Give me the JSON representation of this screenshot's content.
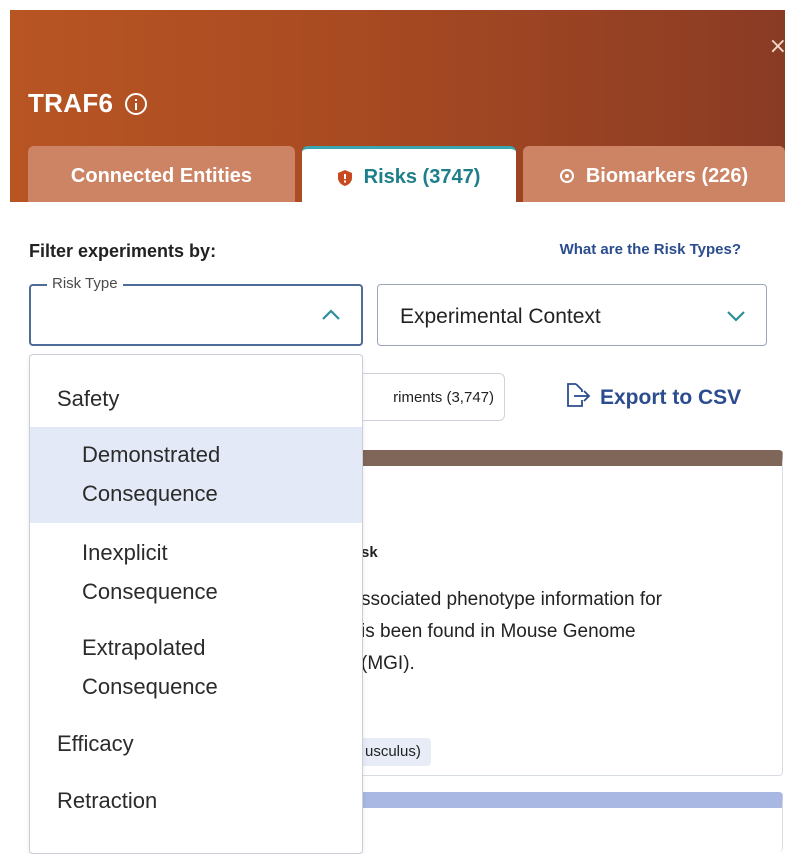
{
  "header": {
    "title": "TRAF6",
    "close_label": "×",
    "tabs": [
      {
        "label": "Connected Entities"
      },
      {
        "label": "Risks (3747)"
      },
      {
        "label": "Biomarkers (226)"
      }
    ]
  },
  "filter": {
    "label": "Filter experiments by:",
    "risk_types_link": "What are the Risk Types?",
    "risk_type_legend": "Risk Type",
    "experimental_context": "Experimental Context"
  },
  "background": {
    "experiments_pill": "riments (3,747)",
    "export_label": "Export to CSV",
    "card_heading": "sk",
    "card_desc_lines": [
      "ssociated phenotype information for",
      "is been found in Mouse Genome",
      "(MGI)."
    ],
    "card_tag": "usculus)"
  },
  "dropdown": {
    "options": [
      {
        "label": "Safety"
      },
      {
        "line1": "Demonstrated",
        "line2": "Consequence"
      },
      {
        "line1": "Inexplicit",
        "line2": "Consequence"
      },
      {
        "line1": "Extrapolated",
        "line2": "Consequence"
      },
      {
        "label": "Efficacy"
      },
      {
        "label": "Retraction"
      }
    ]
  },
  "colors": {
    "header_gradient_start": "#b85523",
    "header_gradient_end": "#8a3b24",
    "active_tab_text": "#1d7f89",
    "link_blue": "#2b4d8f",
    "highlight": "#e3e9f7"
  }
}
